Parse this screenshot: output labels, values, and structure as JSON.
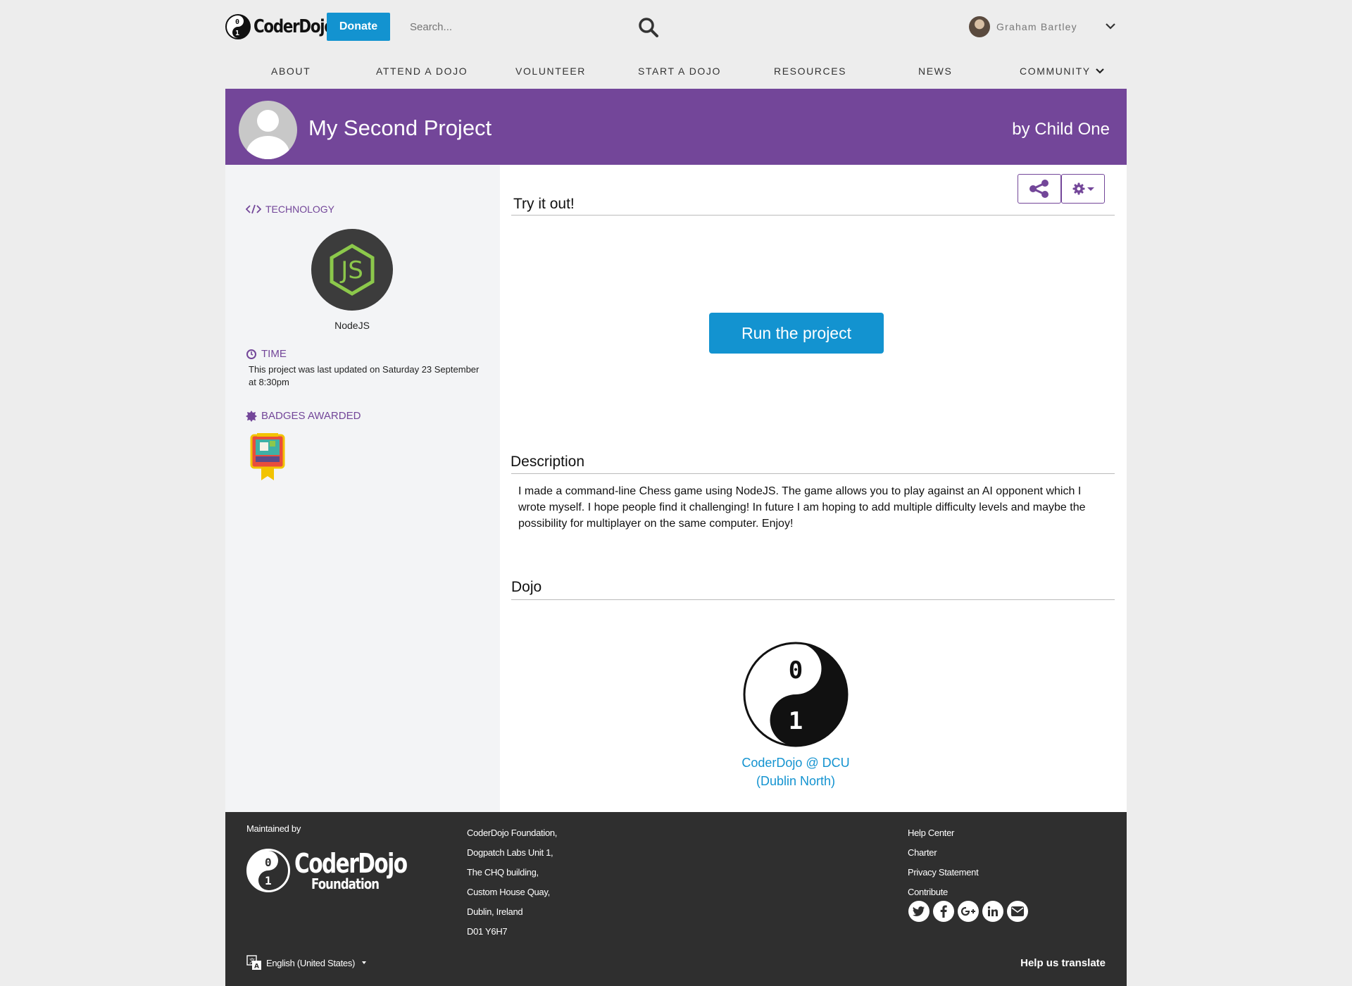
{
  "header": {
    "logo_text": "CoderDojo",
    "logo_glyph_top": "0",
    "logo_glyph_bottom": "1",
    "donate_label": "Donate",
    "search_placeholder": "Search...",
    "user_name": "Graham Bartley"
  },
  "nav": {
    "items": [
      {
        "label": "ABOUT"
      },
      {
        "label": "ATTEND A DOJO"
      },
      {
        "label": "VOLUNTEER"
      },
      {
        "label": "START A DOJO"
      },
      {
        "label": "RESOURCES"
      },
      {
        "label": "NEWS"
      },
      {
        "label": "COMMUNITY"
      }
    ]
  },
  "project": {
    "title": "My Second Project",
    "byline": "by Child One"
  },
  "sidebar": {
    "technology_label": "TECHNOLOGY",
    "technology_name": "NodeJS",
    "technology_logo_text": "JS",
    "time_label": "TIME",
    "time_text": "This project was last updated on Saturday 23 September at 8:30pm",
    "badges_label": "BADGES AWARDED"
  },
  "main": {
    "try_title": "Try it out!",
    "run_label": "Run the project",
    "description_title": "Description",
    "description_text": "I made a command-line Chess game using NodeJS. The game allows you to play against an AI opponent which I wrote myself. I hope people find it challenging! In future I am hoping to add multiple difficulty levels and maybe the possibility for multiplayer on the same computer. Enjoy!",
    "dojo_title": "Dojo",
    "dojo_glyph_top": "0",
    "dojo_glyph_bottom": "1",
    "dojo_name_line1": "CoderDojo @ DCU",
    "dojo_name_line2": "(Dublin North)"
  },
  "footer": {
    "maintained_by": "Maintained by",
    "logo_line1": "CoderDojo",
    "logo_line2": "Foundation",
    "address": [
      "CoderDojo Foundation,",
      "Dogpatch Labs Unit 1,",
      "The CHQ building,",
      "Custom House Quay,",
      "Dublin, Ireland",
      "D01 Y6H7"
    ],
    "links": [
      "Help Center",
      "Charter",
      "Privacy Statement",
      "Contribute"
    ],
    "language": "English (United States)",
    "help_translate": "Help us translate"
  },
  "colors": {
    "brand_purple": "#734699",
    "brand_blue": "#1393d0",
    "footer_bg": "#2f2f2f",
    "node_green": "#8cc84b"
  },
  "icons": [
    "search-icon",
    "chevron-down-icon",
    "code-icon",
    "clock-icon",
    "badge-icon",
    "share-icon",
    "gear-icon",
    "twitter-icon",
    "facebook-icon",
    "google-plus-icon",
    "linkedin-icon",
    "email-icon",
    "translate-icon"
  ]
}
